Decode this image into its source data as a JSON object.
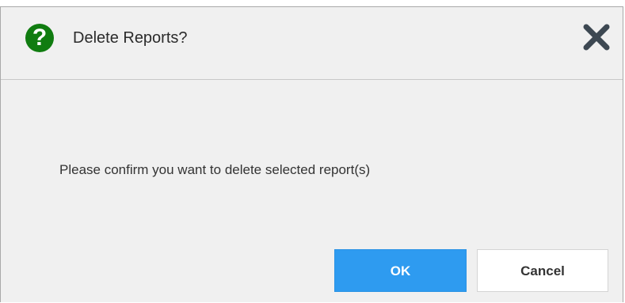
{
  "dialog": {
    "title": "Delete Reports?",
    "title_icon": "question-icon",
    "title_icon_glyph": "?",
    "close_icon": "close-icon",
    "message": "Please confirm you want to delete selected report(s)",
    "ok_label": "OK",
    "cancel_label": "Cancel"
  },
  "colors": {
    "background": "#f0f0f0",
    "icon_green": "#107c10",
    "ok_blue": "#2e9bf0",
    "close_gray": "#3d4852"
  }
}
